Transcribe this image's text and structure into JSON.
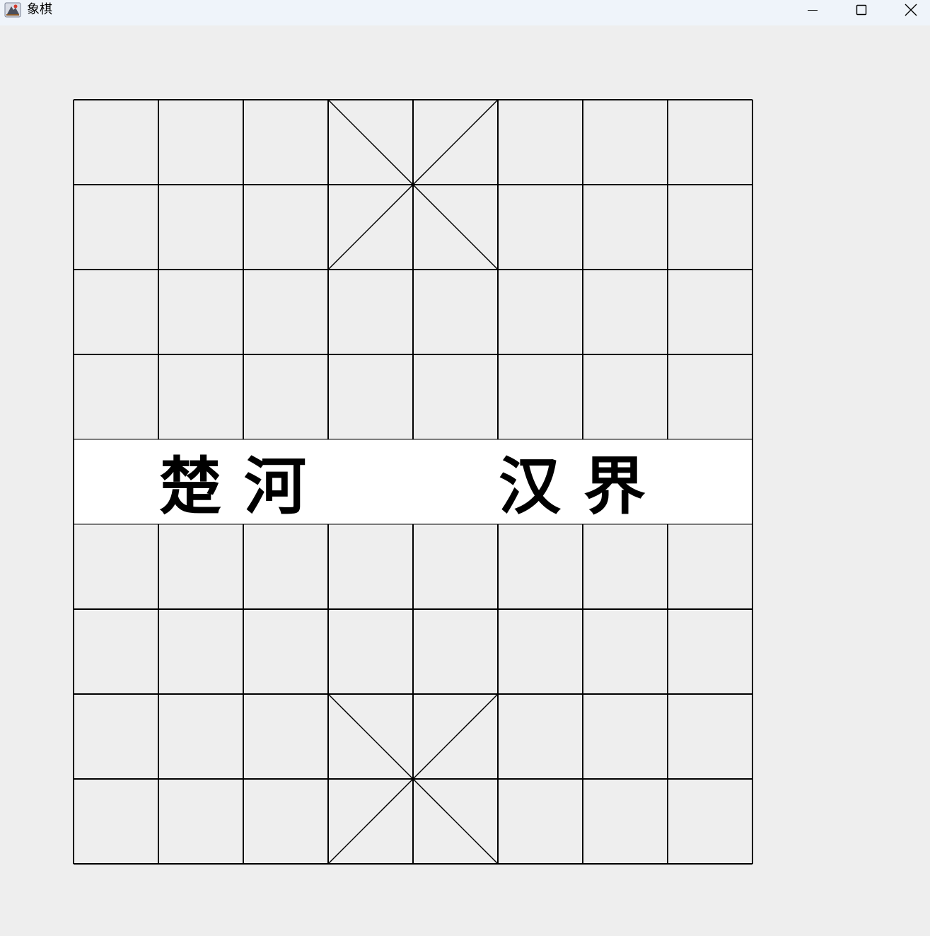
{
  "window": {
    "title": "象棋",
    "icon": "java-app-icon",
    "controls": [
      "minimize-icon",
      "maximize-icon",
      "close-icon"
    ]
  },
  "board": {
    "files": 9,
    "ranks": 10,
    "line_color": "#000000",
    "background_color": "#eeeeee",
    "river_color": "#ffffff",
    "river": {
      "left_text_1": "楚",
      "left_text_2": "河",
      "right_text_1": "汉",
      "right_text_2": "界"
    },
    "palaces": [
      "top",
      "bottom"
    ]
  }
}
